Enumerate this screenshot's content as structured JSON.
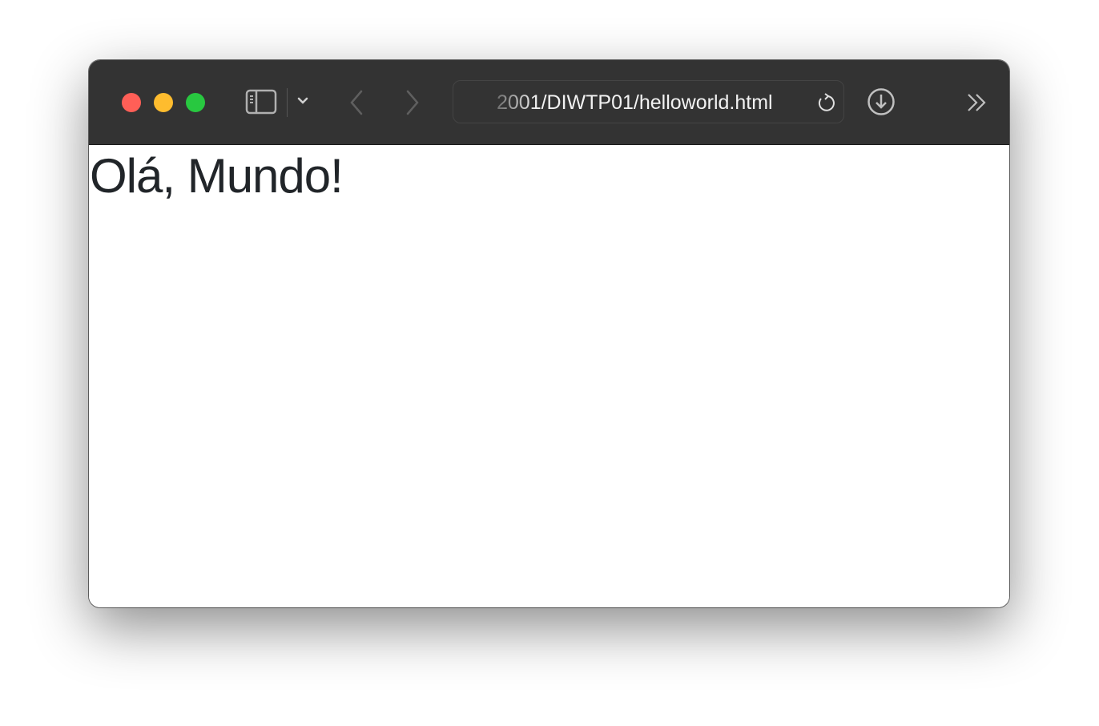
{
  "toolbar": {
    "traffic_lights": {
      "close": "#ff5f57",
      "minimize": "#febc2e",
      "zoom": "#28c840"
    },
    "url": "2001/DIWTP01/helloworld.html",
    "icons": [
      "sidebar-icon",
      "chevron-down-icon",
      "back-icon",
      "forward-icon",
      "reload-icon",
      "download-icon",
      "overflow-icon"
    ]
  },
  "page": {
    "heading": "Olá, Mundo!"
  }
}
